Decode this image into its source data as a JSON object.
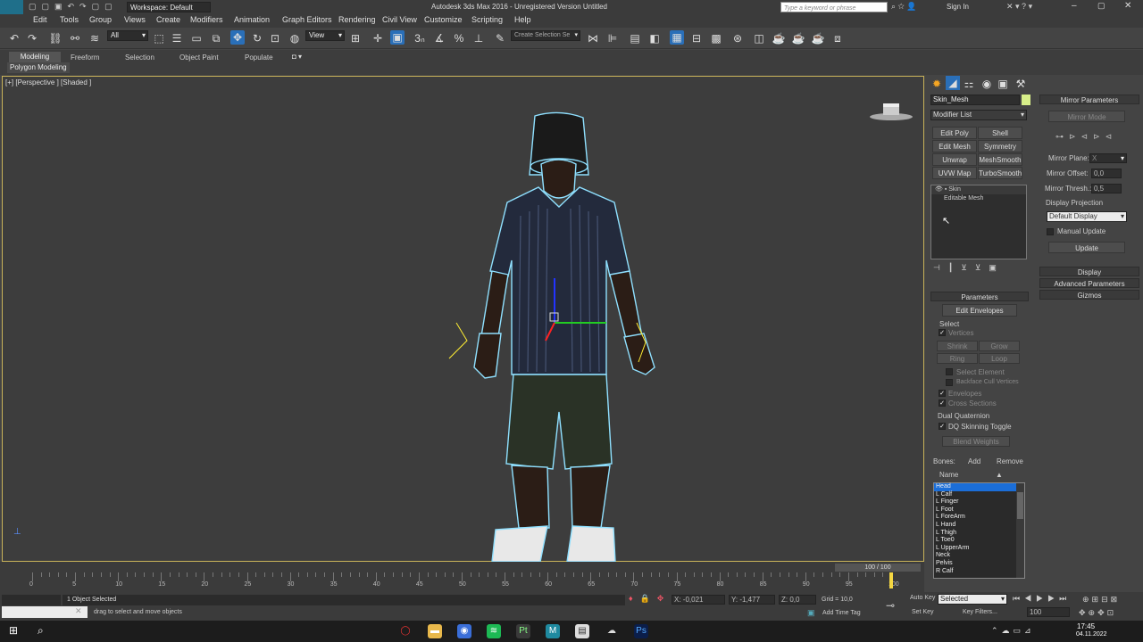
{
  "titlebar": {
    "workspace": "Workspace: Default",
    "title": "Autodesk 3ds Max 2016 - Unregistered Version   Untitled",
    "search_placeholder": "Type a keyword or phrase",
    "signin": "Sign In"
  },
  "menu": [
    "Edit",
    "Tools",
    "Group",
    "Views",
    "Create",
    "Modifiers",
    "Animation",
    "Graph Editors",
    "Rendering",
    "Civil View",
    "Customize",
    "Scripting",
    "Help"
  ],
  "toolbar": {
    "filter": "All",
    "refcoord": "View",
    "selset": "Create Selection Se"
  },
  "ribbon": {
    "tabs": [
      "Modeling",
      "Freeform",
      "Selection",
      "Object Paint",
      "Populate"
    ],
    "sub": "Polygon Modeling"
  },
  "viewport": {
    "label": "[+] [Perspective ] [Shaded ]"
  },
  "cmd": {
    "object_name": "Skin_Mesh",
    "modifier_list": "Modifier List",
    "mod_buttons": [
      "Edit Poly",
      "Shell",
      "Edit Mesh",
      "Symmetry",
      "Unwrap UVW",
      "MeshSmooth",
      "UVW Map",
      "TurboSmooth"
    ],
    "stack": [
      "Skin",
      "Editable Mesh"
    ],
    "params": {
      "title": "Parameters",
      "edit_env": "Edit Envelopes",
      "select": "Select",
      "vertices": "Vertices",
      "shrink": "Shrink",
      "grow": "Grow",
      "ring": "Ring",
      "loop": "Loop",
      "sel_element": "Select Element",
      "backface": "Backface Cull Vertices",
      "envelopes": "Envelopes",
      "cross": "Cross Sections",
      "dq": "Dual Quaternion",
      "dq_toggle": "DQ Skinning Toggle",
      "blend": "Blend Weights",
      "bones": "Bones:",
      "add": "Add",
      "remove": "Remove",
      "name": "Name",
      "bone_list": [
        "Head",
        "L Calf",
        "L Finger",
        "L Foot",
        "L ForeArm",
        "L Hand",
        "L Thigh",
        "L Toe0",
        "L UpperArm",
        "Neck",
        "Pelvis",
        "R Calf"
      ]
    }
  },
  "right": {
    "mirror_params": "Mirror Parameters",
    "mirror_mode": "Mirror Mode",
    "mirror_plane": "Mirror Plane:",
    "plane_val": "X",
    "mirror_offset": "Mirror Offset:",
    "offset_val": "0,0",
    "mirror_thresh": "Mirror Thresh.:",
    "thresh_val": "0,5",
    "display_proj": "Display Projection",
    "default_display": "Default Display",
    "manual_update": "Manual Update",
    "update": "Update",
    "display": "Display",
    "advanced": "Advanced Parameters",
    "gizmos": "Gizmos"
  },
  "timeline": {
    "frame": "100 / 100",
    "ticks": [
      "0",
      "5",
      "10",
      "15",
      "20",
      "25",
      "30",
      "35",
      "40",
      "45",
      "50",
      "55",
      "60",
      "65",
      "70",
      "75",
      "80",
      "85",
      "90",
      "95",
      "100"
    ]
  },
  "status": {
    "selected": "1 Object Selected",
    "prompt": "drag to select and move objects",
    "x": "X: -0,021",
    "y": "Y: -1,477",
    "z": "Z: 0,0",
    "grid": "Grid = 10,0",
    "add_time_tag": "Add Time Tag",
    "auto_key": "Auto Key",
    "set_key": "Set Key",
    "selected_dd": "Selected",
    "key_filters": "Key Filters...",
    "frame_field": "100"
  },
  "taskbar": {
    "time": "17:45",
    "date": "04.11.2022"
  }
}
